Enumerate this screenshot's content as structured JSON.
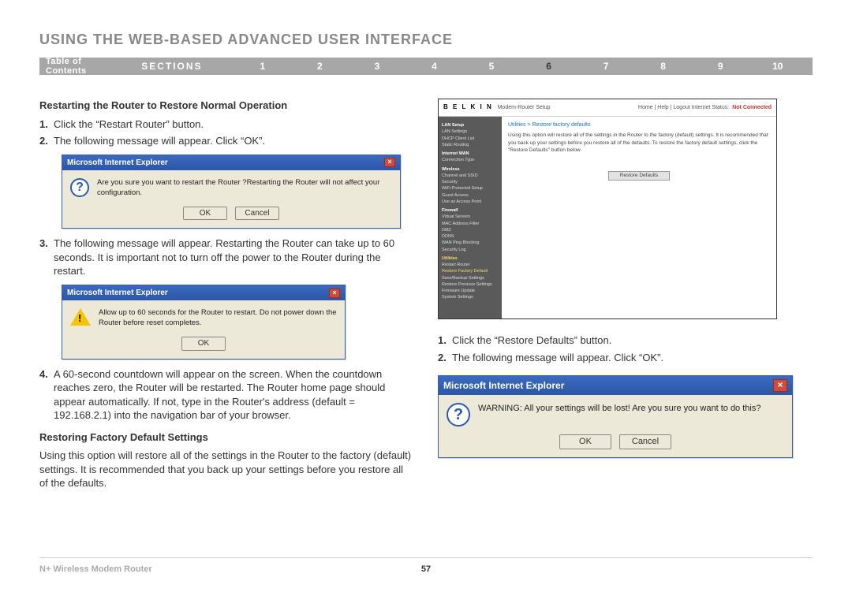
{
  "page": {
    "title": "USING THE WEB-BASED ADVANCED USER INTERFACE",
    "nav": {
      "toc": "Table of Contents",
      "sections": "SECTIONS",
      "numbers": [
        "1",
        "2",
        "3",
        "4",
        "5",
        "6",
        "7",
        "8",
        "9",
        "10"
      ],
      "active": "6"
    },
    "footer": {
      "product": "N+ Wireless Modem Router",
      "page": "57"
    }
  },
  "left": {
    "heading1": "Restarting the Router to Restore Normal Operation",
    "step1": {
      "n": "1.",
      "t": "Click the “Restart Router” button."
    },
    "step2": {
      "n": "2.",
      "t": "The following message will appear. Click “OK”."
    },
    "dialog1": {
      "title": "Microsoft Internet Explorer",
      "msg": "Are you sure you want to restart the Router ?Restarting the Router will not affect your configuration.",
      "ok": "OK",
      "cancel": "Cancel"
    },
    "step3": {
      "n": "3.",
      "t": "The following message will appear. Restarting the Router can take up to 60 seconds. It is important not to turn off the power to the Router during the restart."
    },
    "dialog2": {
      "title": "Microsoft Internet Explorer",
      "msg": "Allow up to 60 seconds for the Router to restart. Do not power down the Router before reset completes.",
      "ok": "OK"
    },
    "step4": {
      "n": "4.",
      "t": "A 60-second countdown will appear on the screen. When the countdown reaches zero, the Router will be restarted. The Router home page should appear automatically. If not, type in the Router's address (default = 192.168.2.1) into the navigation bar of your browser."
    },
    "heading2": "Restoring Factory Default Settings",
    "para2": "Using this option will restore all of the settings in the Router to the factory (default) settings. It is recommended that you back up your settings before you restore all of the defaults."
  },
  "right": {
    "router": {
      "brand": "B E L K I N",
      "product": "Modem-Router Setup",
      "headerLinks": "Home | Help | Logout    Internet Status:",
      "notConnected": "Not Connected",
      "crumb": "Utilities > Restore factory defaults",
      "desc": "Using this option will restore all of the settings in the Router to the factory (default) settings. It is recommended that you back up your settings before you restore all of the defaults. To restore the factory default settings, click the \"Restore Defaults\" button below.",
      "button": "Restore Defaults",
      "side": {
        "lan": "LAN Setup",
        "lan_items": [
          "LAN Settings",
          "DHCP Client List",
          "Static Routing"
        ],
        "internet": "Internet WAN",
        "internet_items": [
          "Connection Type"
        ],
        "wireless": "Wireless",
        "wireless_items": [
          "Channel and SSID",
          "Security",
          "WiFi Protected Setup",
          "Guest Access",
          "Use as Access Point"
        ],
        "firewall": "Firewall",
        "firewall_items": [
          "Virtual Servers",
          "MAC Address Filter",
          "DMZ",
          "DDNS",
          "WAN Ping Blocking",
          "Security Log"
        ],
        "utilities": "Utilities",
        "util_items": [
          "Restart Router",
          "Restore Factory Default",
          "Save/Backup Settings",
          "Restore Previous Settings",
          "Firmware Update",
          "System Settings"
        ]
      }
    },
    "step1": {
      "n": "1.",
      "t": "Click the “Restore Defaults” button."
    },
    "step2": {
      "n": "2.",
      "t": "The following message will appear. Click “OK”."
    },
    "dialog3": {
      "title": "Microsoft Internet Explorer",
      "msg": "WARNING: All your settings will be lost! Are you sure you want to do this?",
      "ok": "OK",
      "cancel": "Cancel"
    }
  }
}
